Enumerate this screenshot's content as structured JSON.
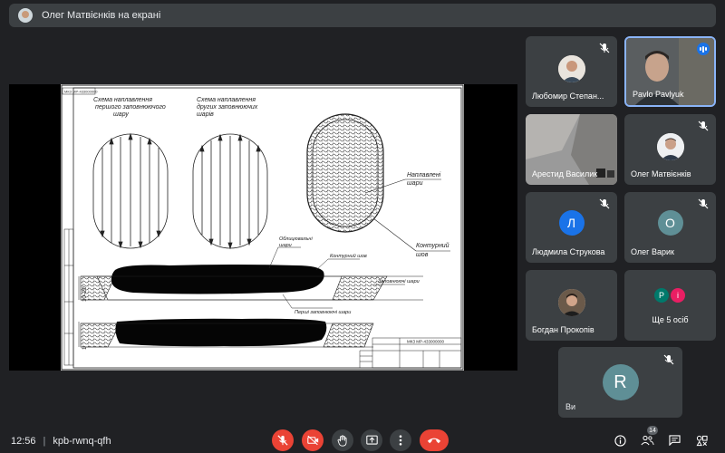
{
  "presenting": {
    "text": "Олег Матвієнків на екрані"
  },
  "drawing": {
    "label_scheme_first": "Схема наплавлення першого заповнюючого шару",
    "label_scheme_others": "Схема наплавлення других заповнюючих шарів",
    "label_layers": "Наплавлені шари",
    "label_contour": "Контурний шов",
    "label_outline": "Облицювальні шари",
    "label_contour_weld": "Контурний шов",
    "label_fill": "Заповнюючі шари",
    "label_first_fill": "Перші заповнюючі шари",
    "dim_top": "10–20",
    "dim_bottom": "10–20",
    "title_block": "МКЗ МР-433000000",
    "corner_stamp": "МКЗ МР-433000000"
  },
  "participants": [
    {
      "name": "Любомир Степан...",
      "kind": "photo",
      "muted": true
    },
    {
      "name": "Pavlo Pavlyuk",
      "kind": "video",
      "muted": false,
      "speaking": true
    },
    {
      "name": "Арестид Василик",
      "kind": "video-room",
      "muted": false
    },
    {
      "name": "Олег Матвієнків",
      "kind": "photo",
      "muted": true
    },
    {
      "name": "Людмила Струкова",
      "kind": "initial",
      "initial": "Л",
      "color": "#1a73e8",
      "muted": true
    },
    {
      "name": "Олег Варик",
      "kind": "initial",
      "initial": "О",
      "color": "#5f8f96",
      "muted": true
    },
    {
      "name": "Богдан Прокопів",
      "kind": "photo",
      "muted": false
    },
    {
      "name": "Ще 5 осіб",
      "kind": "group",
      "initials": [
        "P",
        "i"
      ],
      "colors": [
        "#00796b",
        "#e91e63"
      ],
      "muted": false
    }
  ],
  "self": {
    "name": "Ви",
    "initial": "R",
    "muted": true
  },
  "bottom": {
    "time": "12:56",
    "separator": "|",
    "meeting_code": "kpb-rwnq-qfh",
    "people_count": "14"
  },
  "colors": {
    "background": "#202124",
    "tile": "#3c4043",
    "danger": "#ea4335",
    "accent": "#8ab4f8"
  }
}
